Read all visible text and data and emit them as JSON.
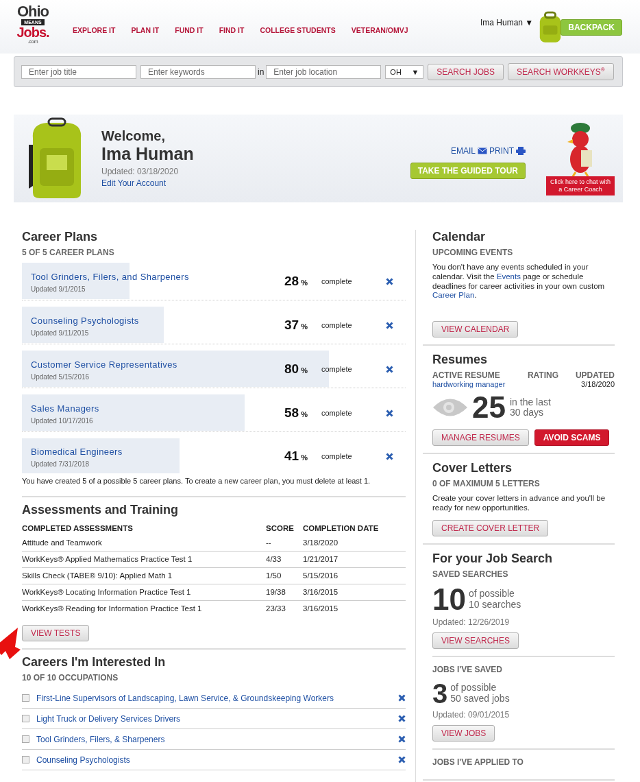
{
  "logo": {
    "line_1": "Ohio",
    "line_2": "MEANS",
    "line_3": "Jobs.",
    "line_4": ".com"
  },
  "nav": [
    "EXPLORE IT",
    "PLAN IT",
    "FUND IT",
    "FIND IT",
    "COLLEGE STUDENTS",
    "VETERAN/OMVJ"
  ],
  "user_menu": {
    "name": "Ima Human",
    "caret": "▼"
  },
  "backpack_button": "BACKPACK",
  "search": {
    "job_title_placeholder": "Enter job title",
    "keywords_placeholder": "Enter keywords",
    "in_label": "in",
    "location_placeholder": "Enter job location",
    "state": "OH",
    "state_caret": "▼",
    "search_jobs": "SEARCH JOBS",
    "search_workkeys": "SEARCH WORKKEYS",
    "workkeys_mark": "®"
  },
  "welcome": {
    "greeting": "Welcome,",
    "name": "Ima Human",
    "updated": "Updated: 03/18/2020",
    "edit_link": "Edit Your Account",
    "email": "EMAIL",
    "print": "PRINT",
    "tour_button": "TAKE THE GUIDED TOUR",
    "coach_button": "Click here to chat with a Career Coach"
  },
  "career_plans": {
    "title": "Career Plans",
    "subtitle": "5 OF 5 CAREER PLANS",
    "note": "You have created 5 of a possible 5 career plans. To create a new career plan, you must delete at least 1.",
    "plans": [
      {
        "name": "Tool Grinders, Filers, and Sharpeners",
        "updated": "Updated 9/1/2015",
        "percent": "28",
        "percent_sign": "%",
        "status": "complete",
        "level": 0.28
      },
      {
        "name": "Counseling Psychologists",
        "updated": "Updated 9/11/2015",
        "percent": "37",
        "percent_sign": "%",
        "status": "complete",
        "level": 0.37
      },
      {
        "name": "Customer Service Representatives",
        "updated": "Updated 5/15/2016",
        "percent": "80",
        "percent_sign": "%",
        "status": "complete",
        "level": 0.8
      },
      {
        "name": "Sales Managers",
        "updated": "Updated 10/17/2016",
        "percent": "58",
        "percent_sign": "%",
        "status": "complete",
        "level": 0.58
      },
      {
        "name": "Biomedical Engineers",
        "updated": "Updated 7/31/2018",
        "percent": "41",
        "percent_sign": "%",
        "status": "complete",
        "level": 0.41
      }
    ]
  },
  "assessments": {
    "title": "Assessments and Training",
    "columns": [
      "COMPLETED ASSESSMENTS",
      "SCORE",
      "COMPLETION DATE"
    ],
    "rows": [
      [
        "Attitude and Teamwork",
        "--",
        "3/18/2020"
      ],
      [
        "WorkKeys® Applied Mathematics Practice Test 1",
        "4/33",
        "1/21/2017"
      ],
      [
        "Skills Check (TABE® 9/10): Applied Math 1",
        "1/50",
        "5/15/2016"
      ],
      [
        "WorkKeys® Locating Information Practice Test 1",
        "19/38",
        "3/16/2015"
      ],
      [
        "WorkKeys® Reading for Information Practice Test 1",
        "23/33",
        "3/16/2015"
      ]
    ],
    "button": "VIEW TESTS"
  },
  "careers": {
    "title": "Careers I'm Interested In",
    "subtitle": "10 OF 10 OCCUPATIONS",
    "items": [
      {
        "name": "First-Line Supervisors of Landscaping, Lawn Service, & Groundskeeping Workers",
        "checked": false
      },
      {
        "name": "Light Truck or Delivery Services Drivers",
        "checked": false
      },
      {
        "name": "Tool Grinders, Filers, & Sharpeners",
        "checked": false
      },
      {
        "name": "Counseling Psychologists",
        "checked": false
      }
    ]
  },
  "calendar": {
    "title": "Calendar",
    "subtitle": "UPCOMING EVENTS",
    "text_1": "You don't have any events scheduled in your calendar. Visit the",
    "events_link": "Events",
    "text_2": "page or schedule deadlines for career activities in your own custom",
    "plan_link": "Career Plan",
    "text_3": ".",
    "button": "VIEW CALENDAR"
  },
  "resumes": {
    "title": "Resumes",
    "col_active": "ACTIVE RESUME",
    "col_rating": "RATING",
    "col_updated": "UPDATED",
    "resume_name": "hardworking manager",
    "updated": "3/18/2020",
    "views": "25",
    "views_line_1": "in the last",
    "views_line_2": "30 days",
    "manage_button": "MANAGE RESUMES",
    "scams_button": "AVOID SCAMS"
  },
  "cover_letters": {
    "title": "Cover Letters",
    "subtitle": "0 OF MAXIMUM 5 LETTERS",
    "text": "Create your cover letters in advance and you'll be ready for new opportunities.",
    "button": "CREATE COVER LETTER"
  },
  "job_search": {
    "title": "For your Job Search",
    "saved_searches": {
      "subtitle": "SAVED SEARCHES",
      "count": "10",
      "line_1": "of possible",
      "line_2": "10 searches",
      "updated": "Updated: 12/26/2019",
      "button": "VIEW SEARCHES"
    },
    "saved_jobs": {
      "subtitle": "JOBS I'VE SAVED",
      "count": "3",
      "line_1": "of possible",
      "line_2": "50 saved jobs",
      "updated": "Updated: 09/01/2015",
      "button": "VIEW JOBS"
    },
    "applied_subtitle": "JOBS I'VE APPLIED TO"
  }
}
